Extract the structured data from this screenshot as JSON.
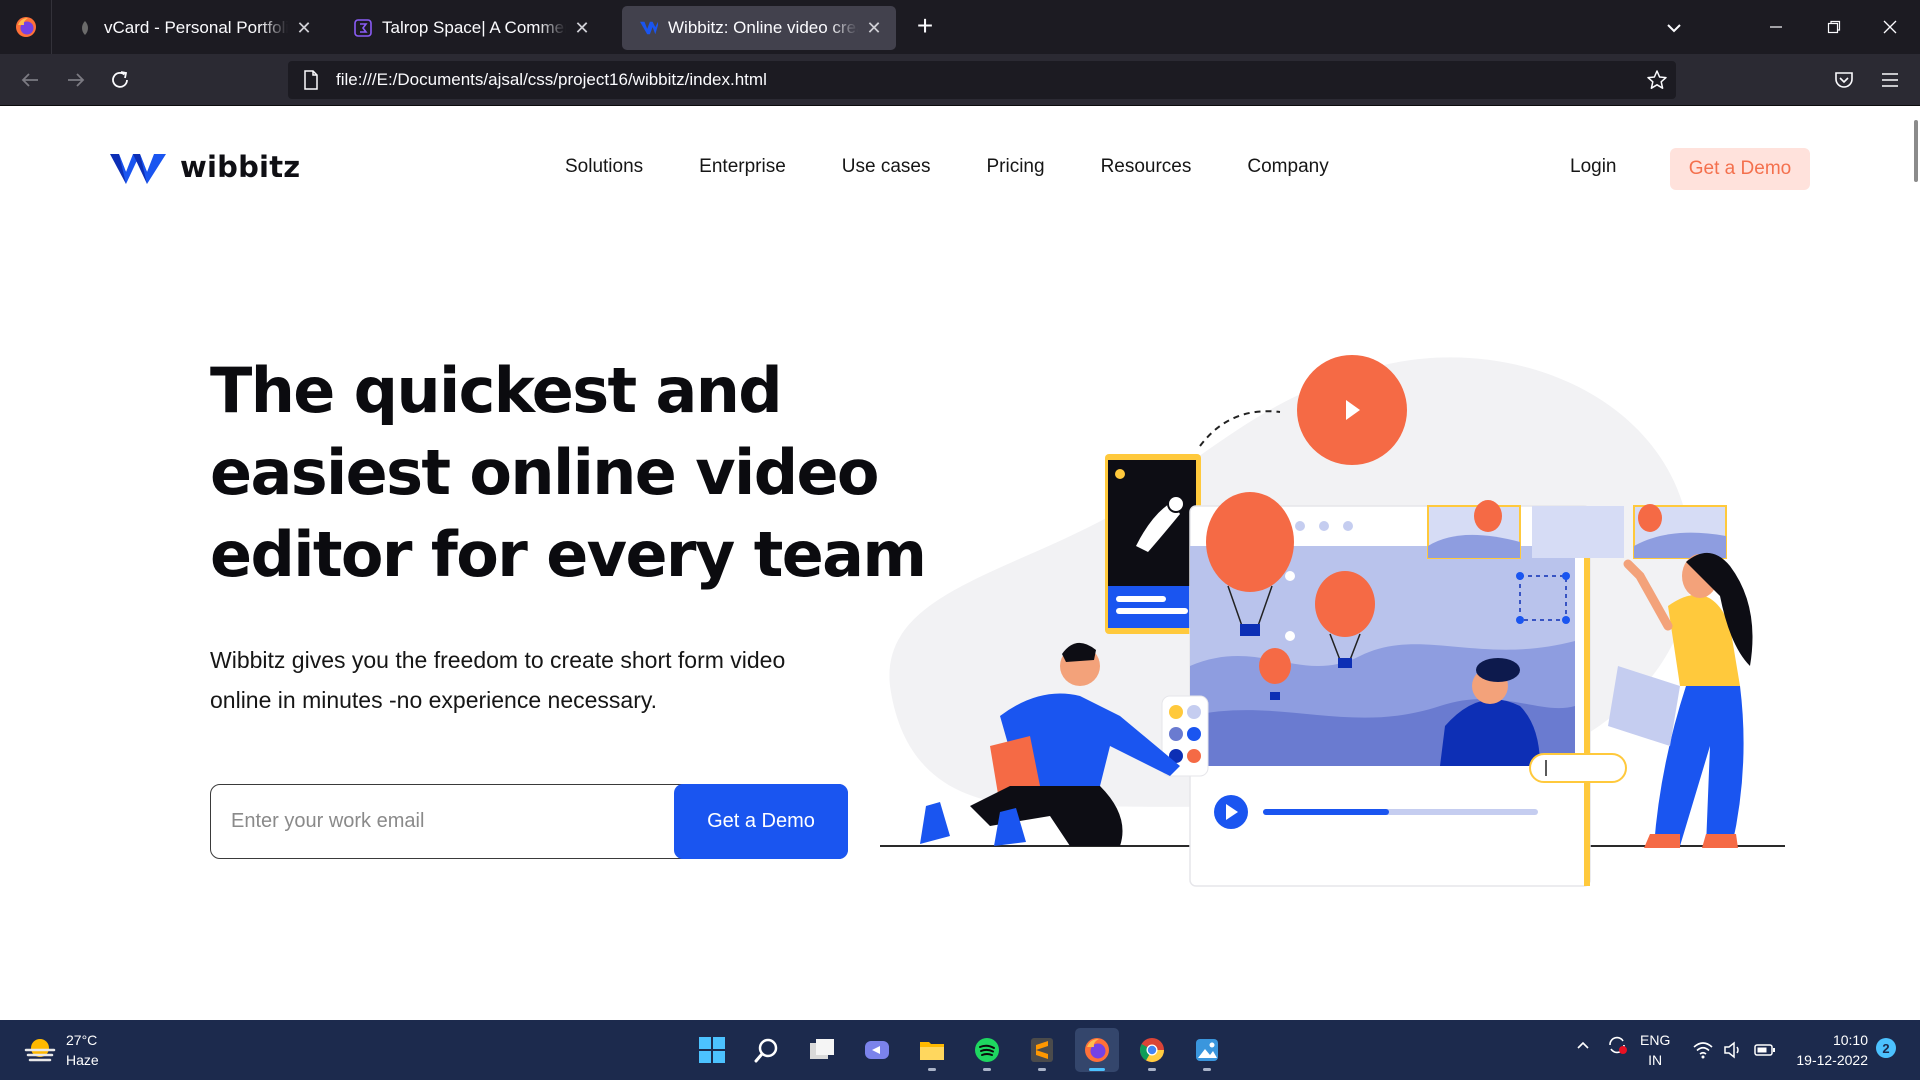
{
  "browser": {
    "tabs": [
      {
        "title": "vCard - Personal Portfolio",
        "active": false
      },
      {
        "title": "Talrop Space| A Commercial Space",
        "active": false
      },
      {
        "title": "Wibbitz: Online video creation made simple",
        "active": true
      }
    ],
    "new_tab_symbol": "+",
    "close_symbol": "✕",
    "url": "file:///E:/Documents/ajsal/css/project16/wibbitz/index.html"
  },
  "site": {
    "brand": "wibbitz",
    "nav": [
      "Solutions",
      "Enterprise",
      "Use cases",
      "Pricing",
      "Resources",
      "Company"
    ],
    "login": "Login",
    "demo_button": "Get a Demo",
    "headline": [
      "The quickest and",
      "easiest online video",
      "editor for every team"
    ],
    "subheadline": [
      "Wibbitz gives you the freedom to create short form video",
      "online in minutes -no experience necessary."
    ],
    "email_placeholder": "Enter your work email",
    "email_submit": "Get a Demo",
    "colors": {
      "accent_blue": "#1a55f0",
      "accent_orange": "#f4704d",
      "demo_bg": "#ffe2dc"
    }
  },
  "taskbar": {
    "weather": {
      "temp": "27°C",
      "condition": "Haze"
    },
    "apps": [
      "start-icon",
      "search-icon",
      "task-view-icon",
      "teams-chat-icon",
      "file-explorer-icon",
      "spotify-icon",
      "sublime-text-icon",
      "firefox-icon",
      "chrome-icon",
      "photos-icon"
    ],
    "language": {
      "line1": "ENG",
      "line2": "IN"
    },
    "time": "10:10",
    "date": "19-12-2022",
    "notifications": "2"
  }
}
